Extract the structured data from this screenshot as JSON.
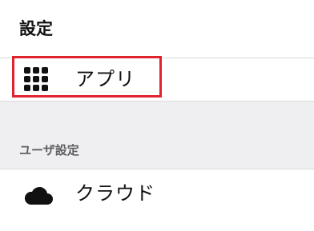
{
  "header": {
    "title": "設定"
  },
  "menu": {
    "apps": {
      "label": "アプリ",
      "icon": "app-grid-icon"
    }
  },
  "user_settings": {
    "section_title": "ユーザ設定",
    "cloud": {
      "label": "クラウド",
      "icon": "cloud-icon"
    }
  },
  "colors": {
    "highlight": "#e0232f",
    "section_background": "#efeff1",
    "section_text": "#5f5f63"
  }
}
